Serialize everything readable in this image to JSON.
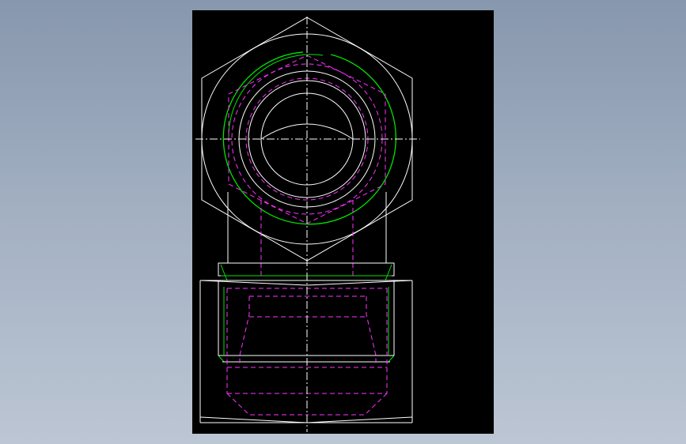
{
  "canvas": {
    "background": "#000000",
    "page_background_top": "#8797ad",
    "page_background_bottom": "#bcc6d4"
  },
  "drawing": {
    "layers": [
      {
        "name": "outline",
        "color": "#ffffff",
        "style": "solid"
      },
      {
        "name": "hidden",
        "color": "#ff33ff",
        "style": "dashed"
      },
      {
        "name": "thread",
        "color": "#00e400",
        "style": "solid"
      },
      {
        "name": "centerline",
        "color": "#ffffff",
        "style": "dash-dot"
      }
    ]
  }
}
